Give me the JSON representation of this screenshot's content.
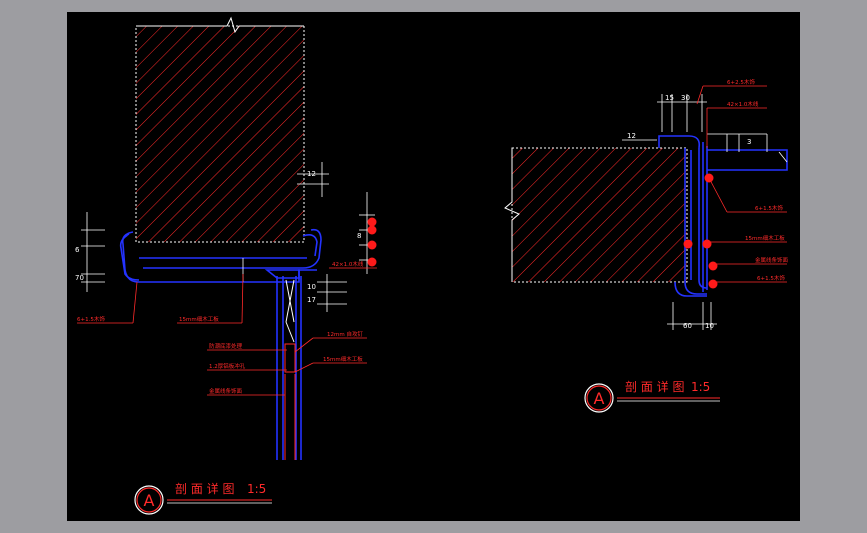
{
  "colors": {
    "background": "#000000",
    "frame": "#9d9da1",
    "hatch": "#ff2a2a",
    "profile": "#2433ff",
    "dimension": "#ffffff",
    "annotation": "#ff2a2a",
    "marker": "#ff1a1a"
  },
  "detail_left": {
    "bubble_letter": "A",
    "title": "剖 面 详 图",
    "scale": "1:5",
    "dims": {
      "d12": "12",
      "d10": "10",
      "d17": "17",
      "d6": "6",
      "d70": "70",
      "d8": "8"
    },
    "labels": {
      "finish_top": "6+1.5木饰",
      "finish_mid": "42×1.0木线",
      "board_left": "6+1.5木饰",
      "base_board": "15mm细木工板",
      "screw": "12mm 自攻钉",
      "glass_a": "防潮底漆处理",
      "glass_b": "15mm细木工板",
      "glass_c": "1.2厚铝板冲孔",
      "glass_d": "金属线条饰面"
    }
  },
  "detail_right": {
    "bubble_letter": "A",
    "title": "剖 面 详 图",
    "scale": "1:5",
    "dims": {
      "d12": "12",
      "d15": "15",
      "d30": "30",
      "d60": "60",
      "d10": "10",
      "d3": "3"
    },
    "labels": {
      "top1": "6+2.5木饰",
      "top2": "42×1.0木线",
      "side1": "6+1.5木饰",
      "side2": "15mm细木工板",
      "side3": "金属线条饰面",
      "side4": "6+1.5木饰"
    }
  }
}
